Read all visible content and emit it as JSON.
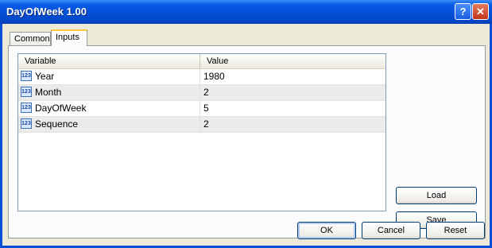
{
  "window": {
    "title": "DayOfWeek 1.00"
  },
  "titlebar": {
    "help_label": "?",
    "close_label": "✕"
  },
  "tabs": [
    {
      "label": "Common"
    },
    {
      "label": "Inputs"
    }
  ],
  "grid": {
    "columns": [
      "Variable",
      "Value"
    ],
    "rows": [
      {
        "variable": "Year",
        "value": "1980"
      },
      {
        "variable": "Month",
        "value": "2"
      },
      {
        "variable": "DayOfWeek",
        "value": "5"
      },
      {
        "variable": "Sequence",
        "value": "2"
      }
    ],
    "icon_text": "123"
  },
  "buttons": {
    "load": "Load",
    "save": "Save",
    "ok": "OK",
    "cancel": "Cancel",
    "reset": "Reset"
  }
}
